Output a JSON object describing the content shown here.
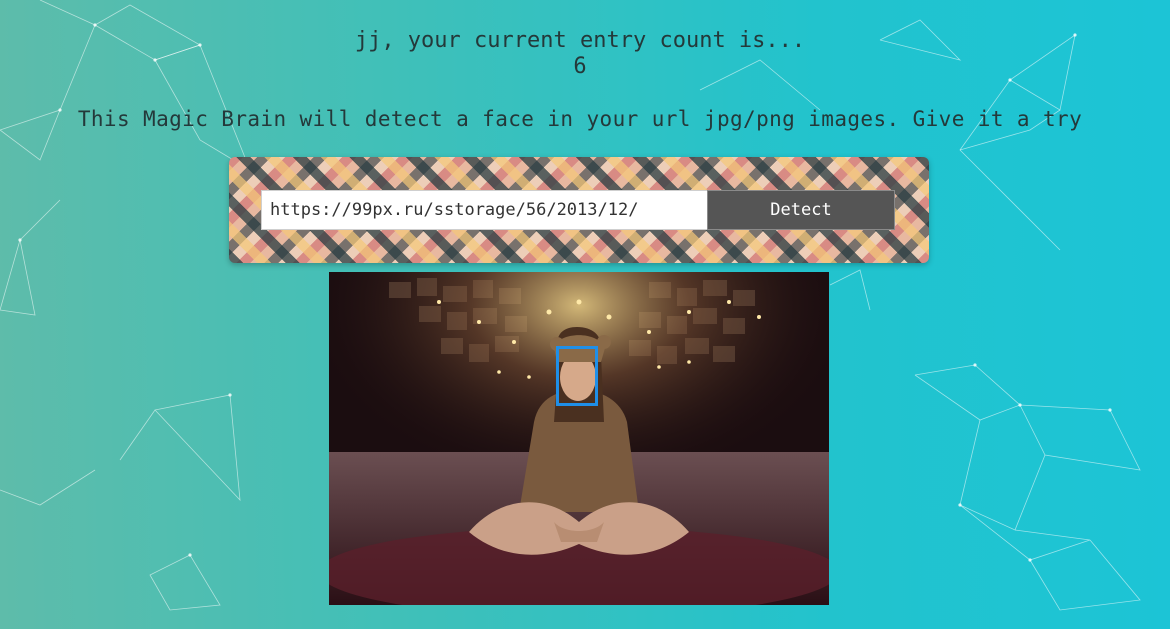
{
  "greeting": {
    "line1": "jj, your current entry count is...",
    "count": "6"
  },
  "tagline": "This Magic Brain will detect a face in your url jpg/png images. Give it a try",
  "form": {
    "url_value": "https://99px.ru/sstorage/56/2013/12/",
    "detect_label": "Detect"
  },
  "photo": {
    "face_box_color": "#1f8fe8"
  },
  "colors": {
    "bg_left": "#5ebcaa",
    "bg_right": "#1cc4d6",
    "button": "#555555"
  }
}
